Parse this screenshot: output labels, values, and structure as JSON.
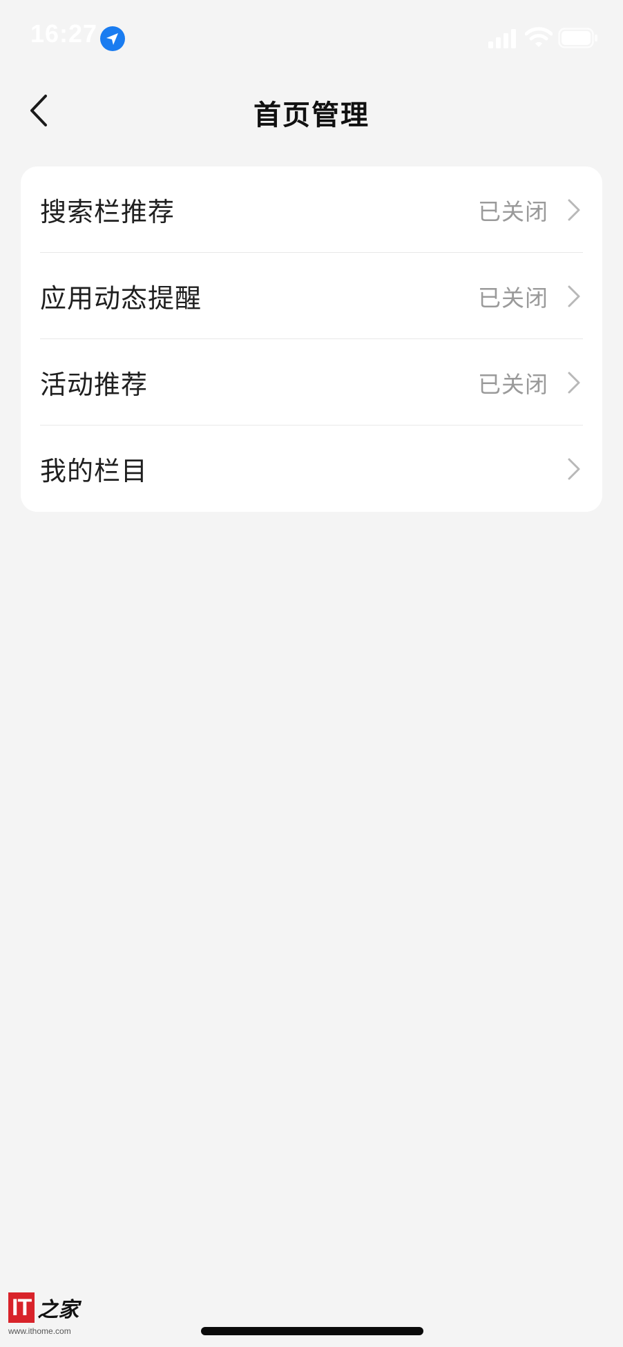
{
  "status_bar": {
    "time": "16:27"
  },
  "header": {
    "title": "首页管理"
  },
  "settings": {
    "items": [
      {
        "label": "搜索栏推荐",
        "value": "已关闭"
      },
      {
        "label": "应用动态提醒",
        "value": "已关闭"
      },
      {
        "label": "活动推荐",
        "value": "已关闭"
      },
      {
        "label": "我的栏目",
        "value": ""
      }
    ]
  },
  "watermark": {
    "logo_text": "IT",
    "logo_suffix": "之家",
    "url": "www.ithome.com"
  },
  "colors": {
    "background": "#f4f4f4",
    "card": "#ffffff",
    "value_text": "#9a9a9a",
    "location_blue": "#1a7cf0",
    "brand_red": "#d8232a"
  }
}
